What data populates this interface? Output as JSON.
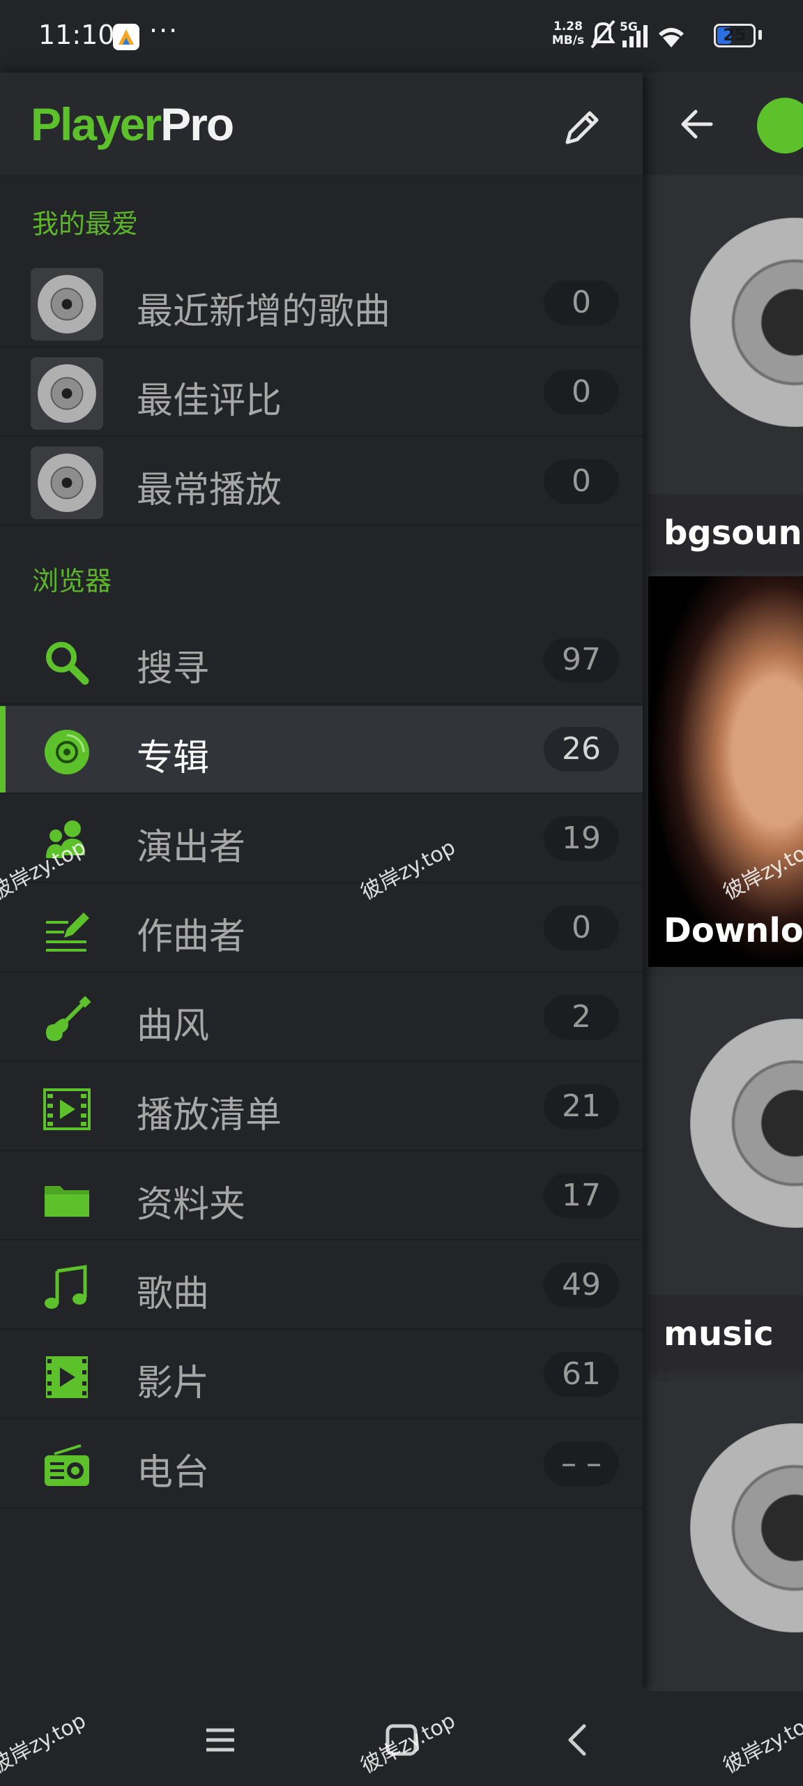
{
  "status_bar": {
    "time": "11:10",
    "more": "···",
    "speed_value": "1.28",
    "speed_unit": "MB/s",
    "network": "5G",
    "battery": "25"
  },
  "app": {
    "logo_part1": "Player",
    "logo_part2": "Pro",
    "accent_color": "#5cc12b"
  },
  "favorites": {
    "title": "我的最爱",
    "items": [
      {
        "label": "最近新增的歌曲",
        "count": "0",
        "icon": "disc-thumbnail"
      },
      {
        "label": "最佳评比",
        "count": "0",
        "icon": "disc-thumbnail"
      },
      {
        "label": "最常播放",
        "count": "0",
        "icon": "disc-thumbnail"
      }
    ]
  },
  "browser": {
    "title": "浏览器",
    "items": [
      {
        "label": "搜寻",
        "count": "97",
        "icon": "search-icon"
      },
      {
        "label": "专辑",
        "count": "26",
        "icon": "album-icon",
        "selected": true
      },
      {
        "label": "演出者",
        "count": "19",
        "icon": "artist-icon"
      },
      {
        "label": "作曲者",
        "count": "0",
        "icon": "composer-icon"
      },
      {
        "label": "曲风",
        "count": "2",
        "icon": "guitar-icon"
      },
      {
        "label": "播放清单",
        "count": "21",
        "icon": "playlist-icon"
      },
      {
        "label": "资料夹",
        "count": "17",
        "icon": "folder-icon"
      },
      {
        "label": "歌曲",
        "count": "49",
        "icon": "music-note-icon"
      },
      {
        "label": "影片",
        "count": "61",
        "icon": "video-icon"
      },
      {
        "label": "电台",
        "count": "– –",
        "icon": "radio-icon"
      }
    ]
  },
  "background_albums": [
    {
      "title": "bgsound"
    },
    {
      "title": "Download"
    },
    {
      "title": "music"
    }
  ],
  "watermark": "彼岸zy.top"
}
